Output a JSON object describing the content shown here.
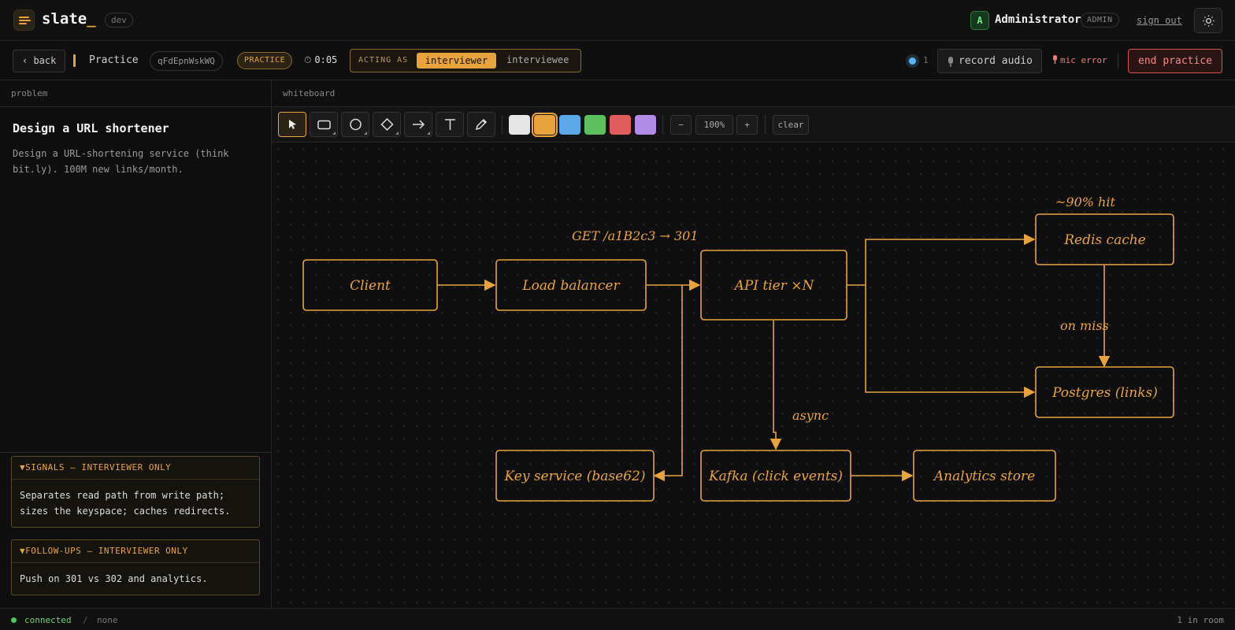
{
  "app": {
    "brand": "slate",
    "brand_cursor": "_",
    "env": "dev"
  },
  "user": {
    "initial": "A",
    "name": "Administrator",
    "role": "ADMIN",
    "signout": "sign out"
  },
  "session": {
    "back": "‹ back",
    "title": "Practice",
    "id": "qFdEpnWskWQ",
    "mode": "PRACTICE",
    "timer": "0:05",
    "acting_label": "ACTING AS",
    "roles": [
      "interviewer",
      "interviewee"
    ],
    "active_role": "interviewer",
    "presence_count": "1",
    "record_label": "record audio",
    "mic_error": "mic error",
    "end_label": "end practice"
  },
  "problem": {
    "header": "problem",
    "title": "Design a URL shortener",
    "description": "Design a URL-shortening service (think bit.ly). 100M new links/month.",
    "signals_header": "▼SIGNALS — INTERVIEWER ONLY",
    "signals_body": "Separates read path from write path; sizes the keyspace; caches redirects.",
    "followups_header": "▼FOLLOW-UPS — INTERVIEWER ONLY",
    "followups_body": "Push on 301 vs 302 and analytics."
  },
  "whiteboard": {
    "header": "whiteboard",
    "tools": [
      "select",
      "rectangle",
      "ellipse",
      "diamond",
      "arrow",
      "text",
      "pen"
    ],
    "colors": [
      "#e6e6e6",
      "#e8a33d",
      "#5aa8e8",
      "#5cbf5e",
      "#e05d5d",
      "#b28be8"
    ],
    "selected_color": "#e8a33d",
    "zoom_out": "−",
    "zoom": "100%",
    "zoom_in": "+",
    "clear": "clear",
    "nodes": {
      "client": "Client",
      "lb": "Load balancer",
      "api": "API tier ×N",
      "redis": "Redis cache",
      "postgres": "Postgres (links)",
      "keysvc": "Key service (base62)",
      "kafka": "Kafka (click events)",
      "analytics": "Analytics store"
    },
    "labels": {
      "get": "GET /a1B2c3 → 301",
      "hit": "~90% hit",
      "miss": "on miss",
      "async": "async"
    }
  },
  "status": {
    "connection": "connected",
    "separator": "/",
    "secondary": "none",
    "room": "1 in room"
  }
}
